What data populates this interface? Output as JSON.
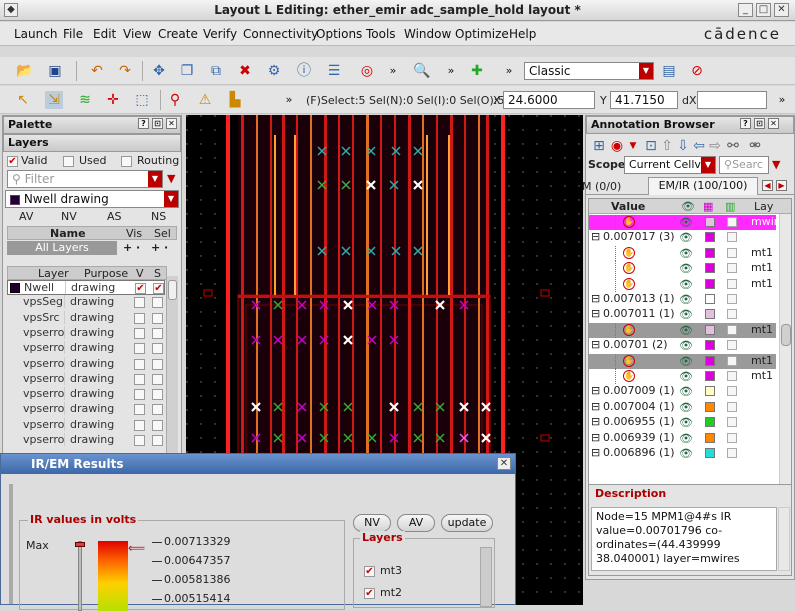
{
  "window": {
    "title": "Layout L Editing: ether_emir adc_sample_hold layout *"
  },
  "menu": [
    "Launch",
    "File",
    "Edit",
    "View",
    "Create",
    "Verify",
    "Connectivity",
    "Options",
    "Tools",
    "Window",
    "Optimize",
    "Help"
  ],
  "brand": "cādence",
  "toolbar": {
    "workspace": "Classic",
    "status": "(F)Select:5  Sel(N):0  Sel(I):0  Sel(O):5",
    "x_label": "X",
    "x_value": "24.6000",
    "y_label": "Y",
    "y_value": "41.7150",
    "dx_label": "dX"
  },
  "palette": {
    "title": "Palette",
    "layers_title": "Layers",
    "valid": "Valid",
    "used": "Used",
    "routing": "Routing",
    "filter_placeholder": "Filter",
    "current_layer": "Nwell drawing",
    "tabs": [
      "AV",
      "NV",
      "AS",
      "NS"
    ],
    "table_headers": {
      "name": "Name",
      "vis": "Vis",
      "sel": "Sel"
    },
    "all_layers": "All Layers",
    "layer_headers": {
      "layer": "Layer",
      "purpose": "Purpose",
      "v": "V",
      "s": "S"
    },
    "layers": [
      {
        "name": "Nwell",
        "purpose": "drawing"
      },
      {
        "name": "vpsSeg",
        "purpose": "drawing"
      },
      {
        "name": "vpsSrc",
        "purpose": "drawing"
      },
      {
        "name": "vpserro",
        "purpose": "drawing"
      },
      {
        "name": "vpserro",
        "purpose": "drawing"
      },
      {
        "name": "vpserro",
        "purpose": "drawing"
      },
      {
        "name": "vpserro",
        "purpose": "drawing"
      },
      {
        "name": "vpserro",
        "purpose": "drawing"
      },
      {
        "name": "vpserro",
        "purpose": "drawing"
      },
      {
        "name": "vpserro",
        "purpose": "drawing"
      },
      {
        "name": "vpserro",
        "purpose": "drawing"
      }
    ]
  },
  "annotation": {
    "title": "Annotation Browser",
    "scope_label": "Scope:",
    "scope_value": "Current Cellvie",
    "search_placeholder": "Searc",
    "tabs": [
      "M (0/0)",
      "EM/IR (100/100)"
    ],
    "headers": {
      "value": "Value",
      "layer": "Lay"
    },
    "rows": [
      {
        "value": "",
        "color": "#e2c0e2",
        "layer": "mwir",
        "indent": 2,
        "selected": true
      },
      {
        "value": "0.007017 (3)",
        "color": "#dd00dd",
        "layer": "",
        "indent": 0
      },
      {
        "value": "",
        "color": "#dd00dd",
        "layer": "mt1",
        "indent": 2
      },
      {
        "value": "",
        "color": "#dd00dd",
        "layer": "mt1",
        "indent": 2
      },
      {
        "value": "",
        "color": "#dd00dd",
        "layer": "mt1",
        "indent": 2
      },
      {
        "value": "0.007013 (1)",
        "color": "#ffffff",
        "layer": "",
        "indent": 0
      },
      {
        "value": "0.007011 (1)",
        "color": "#e2c0e2",
        "layer": "",
        "indent": 0
      },
      {
        "value": "",
        "color": "#e2c0e2",
        "layer": "mt1",
        "indent": 2,
        "grey": true
      },
      {
        "value": "0.00701 (2)",
        "color": "#dd00dd",
        "layer": "",
        "indent": 0
      },
      {
        "value": "",
        "color": "#dd00dd",
        "layer": "mt1",
        "indent": 2,
        "grey": true
      },
      {
        "value": "",
        "color": "#dd00dd",
        "layer": "mt1",
        "indent": 2
      },
      {
        "value": "0.007009 (1)",
        "color": "#ffffc0",
        "layer": "",
        "indent": 0
      },
      {
        "value": "0.007004 (1)",
        "color": "#ff8800",
        "layer": "",
        "indent": 0
      },
      {
        "value": "0.006955 (1)",
        "color": "#22cc22",
        "layer": "",
        "indent": 0
      },
      {
        "value": "0.006939 (1)",
        "color": "#ff8800",
        "layer": "",
        "indent": 0
      },
      {
        "value": "0.006896 (1)",
        "color": "#22dddd",
        "layer": "",
        "indent": 0
      }
    ],
    "description_title": "Description",
    "description": "Node=15 MPM1@4#s  IR value=0.00701796  co-ordinates=(44.439999 38.040001) layer=mwires"
  },
  "irem": {
    "title": "IR/EM Results",
    "group_title": "IR values in volts",
    "max_label": "Max",
    "scale": [
      "0.00713329",
      "0.00647357",
      "0.00581386",
      "0.00515414"
    ],
    "buttons": [
      "NV",
      "AV",
      "update"
    ],
    "layers_title": "Layers",
    "layers": [
      "mt3",
      "mt2"
    ]
  }
}
